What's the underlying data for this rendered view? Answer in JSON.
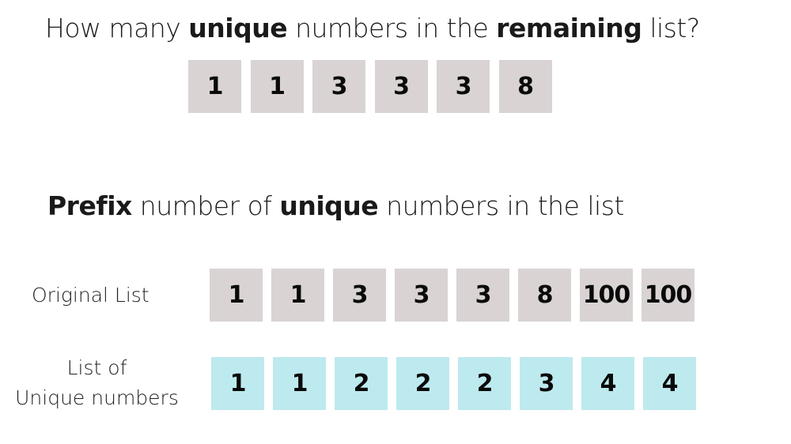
{
  "question": {
    "parts": [
      {
        "text": "How many ",
        "bold": false
      },
      {
        "text": "unique",
        "bold": true
      },
      {
        "text": " numbers in the ",
        "bold": false
      },
      {
        "text": "remaining",
        "bold": true
      },
      {
        "text": " list?",
        "bold": false
      }
    ],
    "remaining_list": [
      "1",
      "1",
      "3",
      "3",
      "3",
      "8"
    ]
  },
  "prefix": {
    "parts": [
      {
        "text": "Prefix",
        "bold": true
      },
      {
        "text": " number of ",
        "bold": false
      },
      {
        "text": "unique",
        "bold": true
      },
      {
        "text": " numbers in the list",
        "bold": false
      }
    ],
    "original_label": "Original List",
    "original_list": [
      "1",
      "1",
      "3",
      "3",
      "3",
      "8",
      "100",
      "100"
    ],
    "unique_label_line1": "List of",
    "unique_label_line2": "Unique numbers",
    "unique_counts": [
      "1",
      "1",
      "2",
      "2",
      "2",
      "3",
      "4",
      "4"
    ]
  },
  "colors": {
    "original_cell": "#d9d3d3",
    "unique_cell": "#bdeaee"
  }
}
